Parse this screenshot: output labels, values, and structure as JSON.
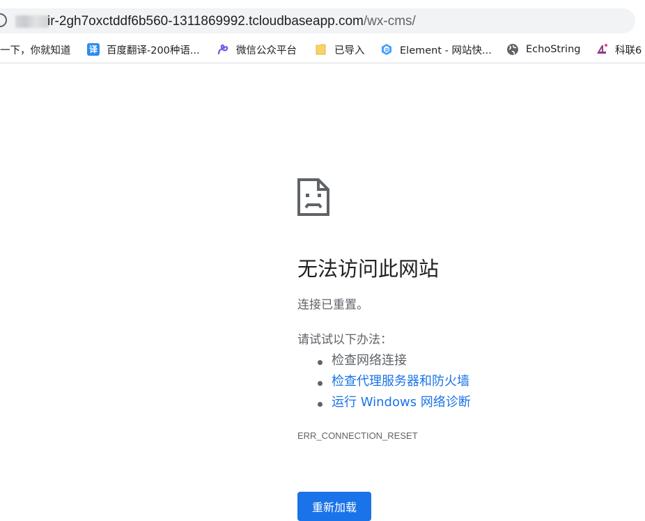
{
  "address_bar": {
    "host": "ir-2gh7oxctddf6b560-1311869992.tcloudbaseapp.com",
    "path": "/wx-cms/"
  },
  "bookmarks": [
    {
      "label": "一下，你就知道",
      "icon": "none"
    },
    {
      "label": "百度翻译-200种语...",
      "icon": "translate-icon",
      "glyph": "译"
    },
    {
      "label": "微信公众平台",
      "icon": "wechat-mp-icon"
    },
    {
      "label": "已导入",
      "icon": "folder-icon"
    },
    {
      "label": "Element - 网站快...",
      "icon": "element-icon"
    },
    {
      "label": "EchoString",
      "icon": "globe-icon"
    },
    {
      "label": "科联6",
      "icon": "kelian-icon"
    }
  ],
  "error": {
    "icon": "sad-page-icon",
    "title": "无法访问此网站",
    "subtitle": "连接已重置。",
    "try_label": "请试试以下办法：",
    "suggestions": [
      {
        "text": "检查网络连接",
        "link": false
      },
      {
        "text": "检查代理服务器和防火墙",
        "link": true
      },
      {
        "text": "运行 Windows 网络诊断",
        "link": true
      }
    ],
    "code": "ERR_CONNECTION_RESET",
    "reload_label": "重新加载"
  },
  "colors": {
    "link": "#1a73e8",
    "button": "#1a73e8",
    "text": "#202124",
    "muted": "#5f6368",
    "omnibox": "#f1f3f4"
  }
}
